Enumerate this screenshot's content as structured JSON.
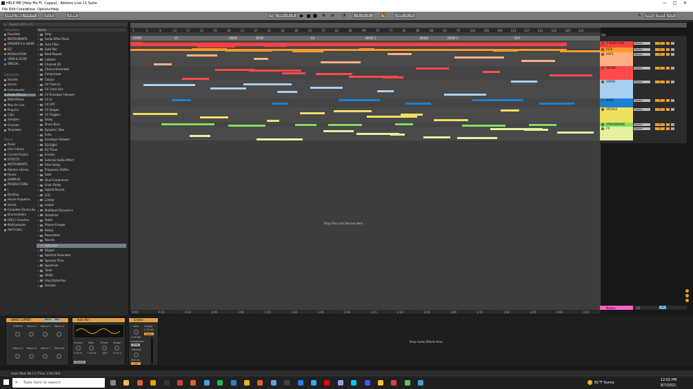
{
  "window": {
    "title": "HELP ME  [Help Me Ft. Cappa] - Ableton Live 11 Suite",
    "controls": [
      "—",
      "□",
      "✕"
    ]
  },
  "menu": [
    "File",
    "Edit",
    "Create",
    "View",
    "Options",
    "Help"
  ],
  "transport": {
    "link": "Link",
    "tap": "Tap",
    "tempo": "124.00",
    "signature": "4 / 4",
    "quant": "1 Bar",
    "position": "121 .   4 .   3",
    "loop_start": "1 .   1 .   1",
    "loop_len": "129 .   2 .   0",
    "key": "Key",
    "midi": "MIDI",
    "cpu": "3 %"
  },
  "browser": {
    "search_placeholder": "Search (Ctrl + F)",
    "collections_label": "Collections",
    "collections": [
      {
        "label": "Favorites",
        "color": "#aaaaaa"
      },
      {
        "label": "INSTRUMENTS",
        "color": "#e05050"
      },
      {
        "label": "DYNAMICS & HARM",
        "color": "#e09040"
      },
      {
        "label": "EQ",
        "color": "#e0d040"
      },
      {
        "label": "MODULATION",
        "color": "#60c060"
      },
      {
        "label": "VERB & ECHO",
        "color": "#40a0e0"
      },
      {
        "label": "SPECIAL",
        "color": "#a060e0"
      }
    ],
    "categories_label": "Categories",
    "categories": [
      "Sounds",
      "Drums",
      "Instruments",
      "Audio Effects",
      "MIDI Effects",
      "Max for Live",
      "Plug-Ins",
      "Clips",
      "Samples",
      "Grooves",
      "Templates"
    ],
    "places_label": "Places",
    "places": [
      "Packs",
      "User Library",
      "Current Project",
      "EFFECTS",
      "INSTRUMENTS",
      "Ableton Library",
      "House",
      "SAMPLES",
      "PRODUCTIONS",
      "\\",
      "Desktop",
      "House Acapellas",
      "Vocals",
      "Complete Drums Bu",
      "Drumsolution",
      "(DDC) Favorites",
      "Multisamples",
      "Add Folder..."
    ],
    "name_header": "Name",
    "items": [
      "Amp",
      "Audio Effect Rack",
      "Auto Filter",
      "Auto Pan",
      "Beat Repeat",
      "Cabinet",
      "Channel EQ",
      "Chorus-Ensemble",
      "Compressor",
      "Corpus",
      "CV Clock In",
      "CV Clock Out",
      "CV Envelope Follower",
      "CV In",
      "CV LFO",
      "CV Shaper",
      "CV Triggers",
      "Delay",
      "Drum Buss",
      "Dynamic Tube",
      "Echo",
      "Envelope Follower",
      "EQ Eight",
      "EQ Three",
      "Erosion",
      "External Audio Effect",
      "Filter Delay",
      "Frequency Shifter",
      "Gate",
      "Glue Compressor",
      "Grain Delay",
      "Hybrid Reverb",
      "LFO",
      "Limiter",
      "Looper",
      "Multiband Dynamics",
      "Overdrive",
      "Pedal",
      "Phaser-Flanger",
      "Redux",
      "Resonators",
      "Reverb",
      "Saturator",
      "Shaper",
      "Spectral Resonator",
      "Spectral Time",
      "Spectrum",
      "Tuner",
      "Utility",
      "Vinyl Distortion",
      "Vocoder"
    ],
    "selected": "Saturator"
  },
  "arrangement": {
    "bars": [
      "1",
      "5",
      "9",
      "13",
      "17",
      "21",
      "25",
      "29",
      "33",
      "37",
      "41",
      "45",
      "49",
      "53",
      "57",
      "61",
      "65",
      "69",
      "73",
      "77",
      "81",
      "85",
      "89",
      "93",
      "97",
      "101",
      "105",
      "109",
      "113",
      "117",
      "121",
      "125",
      "129",
      "133"
    ],
    "locators": [
      "START",
      "V1",
      "HOOK",
      "DROP",
      "V2",
      "HOOK 2",
      "BUILD",
      "DROP 2",
      "OUT"
    ],
    "times": [
      "0:00",
      "0:15",
      "0:30",
      "0:45",
      "1:00",
      "1:15",
      "1:30",
      "1:45",
      "2:00",
      "2:15",
      "2:30",
      "2:45",
      "3:00",
      "3:15",
      "3:30",
      "3:45",
      "4:00",
      "4:15"
    ],
    "drop_text": "Drop Files and Devices Here",
    "set_label": "Set"
  },
  "tracks": [
    {
      "name": "2 SIDECHAIN",
      "color": "#ff4040",
      "vol": "0"
    },
    {
      "name": "KICK",
      "color": "#ff9a30",
      "vol": "0"
    },
    {
      "name": "HATS",
      "color": "#ffb080",
      "vol": "0"
    },
    {
      "name": "DRUMS",
      "color": "#ff4a4a",
      "vol": "0"
    },
    {
      "name": "SYNTH",
      "color": "#a8d0f0",
      "vol": "0"
    },
    {
      "name": "BASS",
      "color": "#1a80d0",
      "vol": "0"
    },
    {
      "name": "VOCALS",
      "color": "#f0e060",
      "vol": "0"
    },
    {
      "name": "ATMOSPHERE",
      "color": "#80e060",
      "vol": "0"
    },
    {
      "name": "FX",
      "color": "#e8f0a0",
      "vol": "0"
    }
  ],
  "master": {
    "name": "Master",
    "route": "1/2",
    "vol": "0"
  },
  "devices": [
    {
      "name": "WAVE CLIPPER",
      "macros": [
        "THRESH",
        "Macro 2",
        "Macro 3",
        "Macro 4",
        "Macro 5",
        "Macro 6",
        "Macro 7",
        "Macro 8"
      ],
      "buttons": [
        "Rand",
        "Map"
      ]
    },
    {
      "name": "Auto Pan",
      "amount_label": "Amount",
      "amount": "0.00 %",
      "rate_label": "Rate",
      "rate": "7.02 Hz",
      "phase_label": "Phase",
      "phase": "180°",
      "shape_label": "Shape",
      "shape": "0.00 %",
      "mode": "Normal"
    },
    {
      "name": "Limiter",
      "gain_label": "Gain",
      "gain": "0.00 dB",
      "ceiling_label": "Ceiling",
      "ceiling": "-0.30 dB",
      "lookahead_label": "Lookahead",
      "lookahead": "3 ms",
      "release_label": "Release",
      "release": "300 ms",
      "auto": "Auto",
      "stereo": "Stereo"
    }
  ],
  "device_drop_text": "Drop Audio Effects Here",
  "device_track": "SYNTH",
  "status": "Insert Mark 88.1.1 (Time: 2:50:203)",
  "taskbar": {
    "search_placeholder": "Type here to search",
    "weather": "81°F Sunny",
    "time": "12:02 PM",
    "date": "8/7/2021"
  },
  "colors": {
    "accent": "#e8a030",
    "selection": "#6f8089"
  }
}
